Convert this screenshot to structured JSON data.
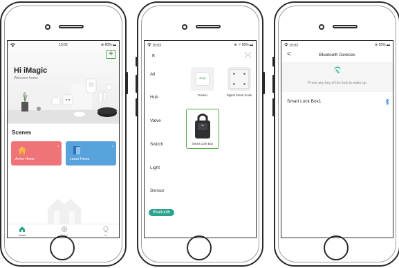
{
  "screen1": {
    "status": {
      "time": "15:02",
      "battery": "60%"
    },
    "greeting": "Hi iMagic",
    "welcome": "Welcome home",
    "add_icon": "+",
    "scenes_title": "Scenes",
    "scenes": [
      {
        "label": "Arrive Home",
        "color": "#ee7478",
        "icon": "house-icon"
      },
      {
        "label": "Leave Home",
        "color": "#58a3dc",
        "icon": "door-icon"
      }
    ],
    "tabs": [
      {
        "label": "Home",
        "icon": "home-icon",
        "active": true
      },
      {
        "label": "Scene",
        "icon": "scene-icon",
        "active": false
      },
      {
        "label": "Me",
        "icon": "person-icon",
        "active": false
      }
    ]
  },
  "screen2": {
    "status": {
      "time": "15:03",
      "battery": "56%"
    },
    "close_icon": "×",
    "categories": [
      "All",
      "Hub",
      "Valve",
      "Switch",
      "Light",
      "Sensor",
      "Bluetooth"
    ],
    "active_category": "Bluetooth",
    "products": [
      {
        "label": "Tracker",
        "icon": "tracker-icon"
      },
      {
        "label": "Digital Smart Scale",
        "icon": "scale-icon"
      },
      {
        "label": "Smart Lock Box",
        "icon": "lock-box-icon",
        "selected": true
      }
    ],
    "tracker_brand": "iMagic"
  },
  "screen3": {
    "status": {
      "time": "15:03",
      "battery": "55%"
    },
    "back_icon": "<",
    "title": "Bluetooth Devices",
    "hint": "Press any key of the lock to wake up",
    "devices": [
      {
        "name": "Smart Lock Box1",
        "icon": "bluetooth-icon"
      }
    ]
  },
  "colors": {
    "accent_green": "#4ea94b",
    "teal": "#2aa38d",
    "bluetooth_blue": "#3b8ee6"
  }
}
